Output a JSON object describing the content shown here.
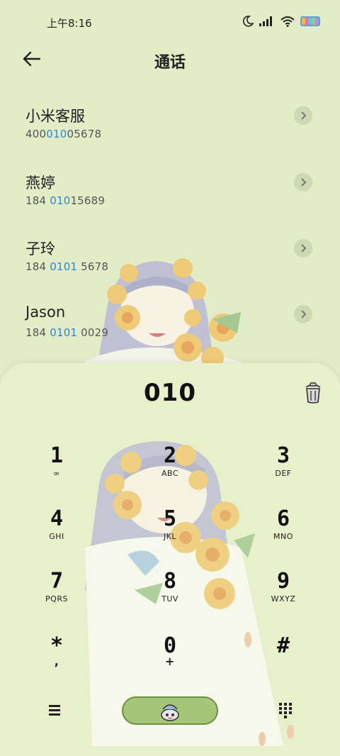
{
  "status": {
    "time": "上午8:16",
    "icons": [
      "moon-icon",
      "signal-icon",
      "wifi-icon",
      "battery-icon"
    ]
  },
  "header": {
    "title": "通话",
    "back_icon": "back-arrow-icon"
  },
  "contacts": [
    {
      "name": "小米客服",
      "number_pre": "400",
      "number_hl": "010",
      "number_post": "05678"
    },
    {
      "name": "燕婷",
      "number_pre": "184 ",
      "number_hl": "010",
      "number_post": "15689"
    },
    {
      "name": "子玲",
      "number_pre": "184 ",
      "number_hl": "0101",
      "number_post": " 5678"
    },
    {
      "name": "Jason",
      "number_pre": "184 ",
      "number_hl": "0101",
      "number_post": " 0029"
    }
  ],
  "dialer": {
    "display": "010",
    "keys": [
      {
        "digit": "1",
        "letters": "∞"
      },
      {
        "digit": "2",
        "letters": "ABC"
      },
      {
        "digit": "3",
        "letters": "DEF"
      },
      {
        "digit": "4",
        "letters": "GHI"
      },
      {
        "digit": "5",
        "letters": "JKL"
      },
      {
        "digit": "6",
        "letters": "MNO"
      },
      {
        "digit": "7",
        "letters": "PQRS"
      },
      {
        "digit": "8",
        "letters": "TUV"
      },
      {
        "digit": "9",
        "letters": "WXYZ"
      },
      {
        "digit": "*",
        "letters": ","
      },
      {
        "digit": "0",
        "letters": "+"
      },
      {
        "digit": "#",
        "letters": ""
      }
    ]
  },
  "colors": {
    "background": "#e2ecc6",
    "sheet": "#e7efcb",
    "highlight": "#2b86d6",
    "call_button": "#a6c677"
  }
}
